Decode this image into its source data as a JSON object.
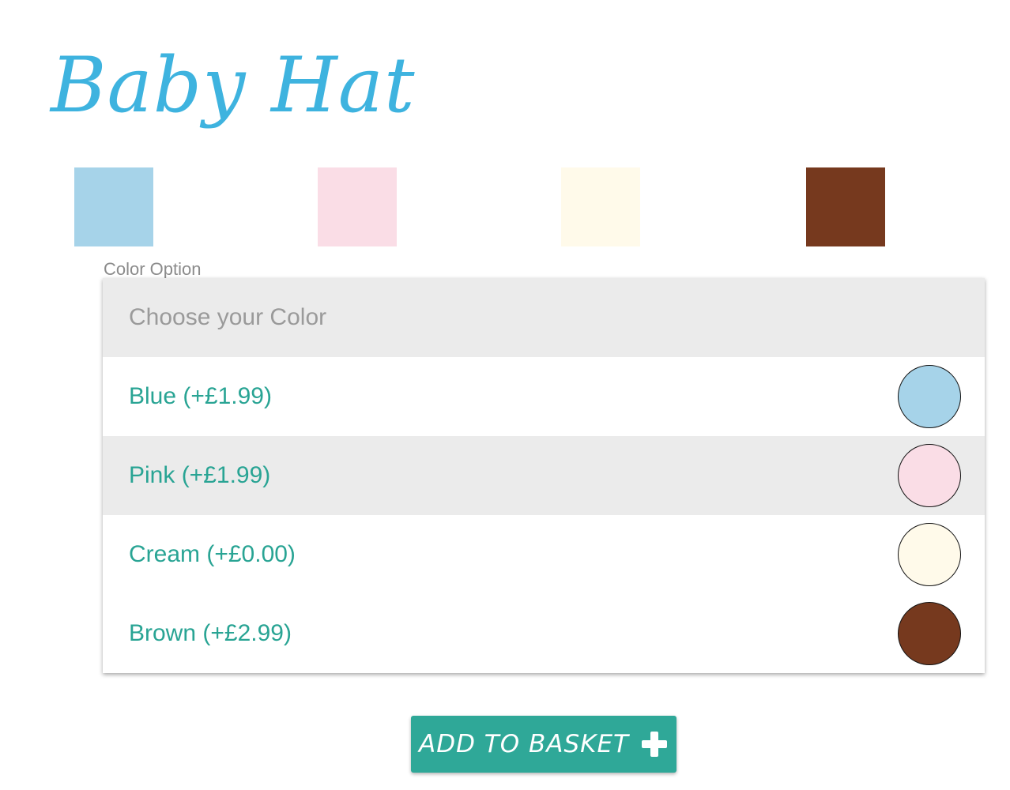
{
  "product": {
    "title": "Baby Hat"
  },
  "swatches": [
    {
      "name": "Blue",
      "color": "#a6d3e9"
    },
    {
      "name": "Pink",
      "color": "#fadde6"
    },
    {
      "name": "Cream",
      "color": "#fffaea"
    },
    {
      "name": "Brown",
      "color": "#76391e"
    }
  ],
  "color_select": {
    "label": "Color Option",
    "placeholder": "Choose your Color",
    "options": [
      {
        "label": "Blue (+£1.99)",
        "color": "#a6d3e9",
        "highlighted": false
      },
      {
        "label": "Pink (+£1.99)",
        "color": "#fadde6",
        "highlighted": true
      },
      {
        "label": "Cream (+£0.00)",
        "color": "#fffaea",
        "highlighted": false
      },
      {
        "label": "Brown (+£2.99)",
        "color": "#76391e",
        "highlighted": false
      }
    ]
  },
  "actions": {
    "add_to_basket_label": "ADD TO BASKET",
    "add_icon": "plus-icon"
  },
  "colors": {
    "title": "#3eb3df",
    "accent": "#2fa898",
    "option_text": "#29a494"
  }
}
